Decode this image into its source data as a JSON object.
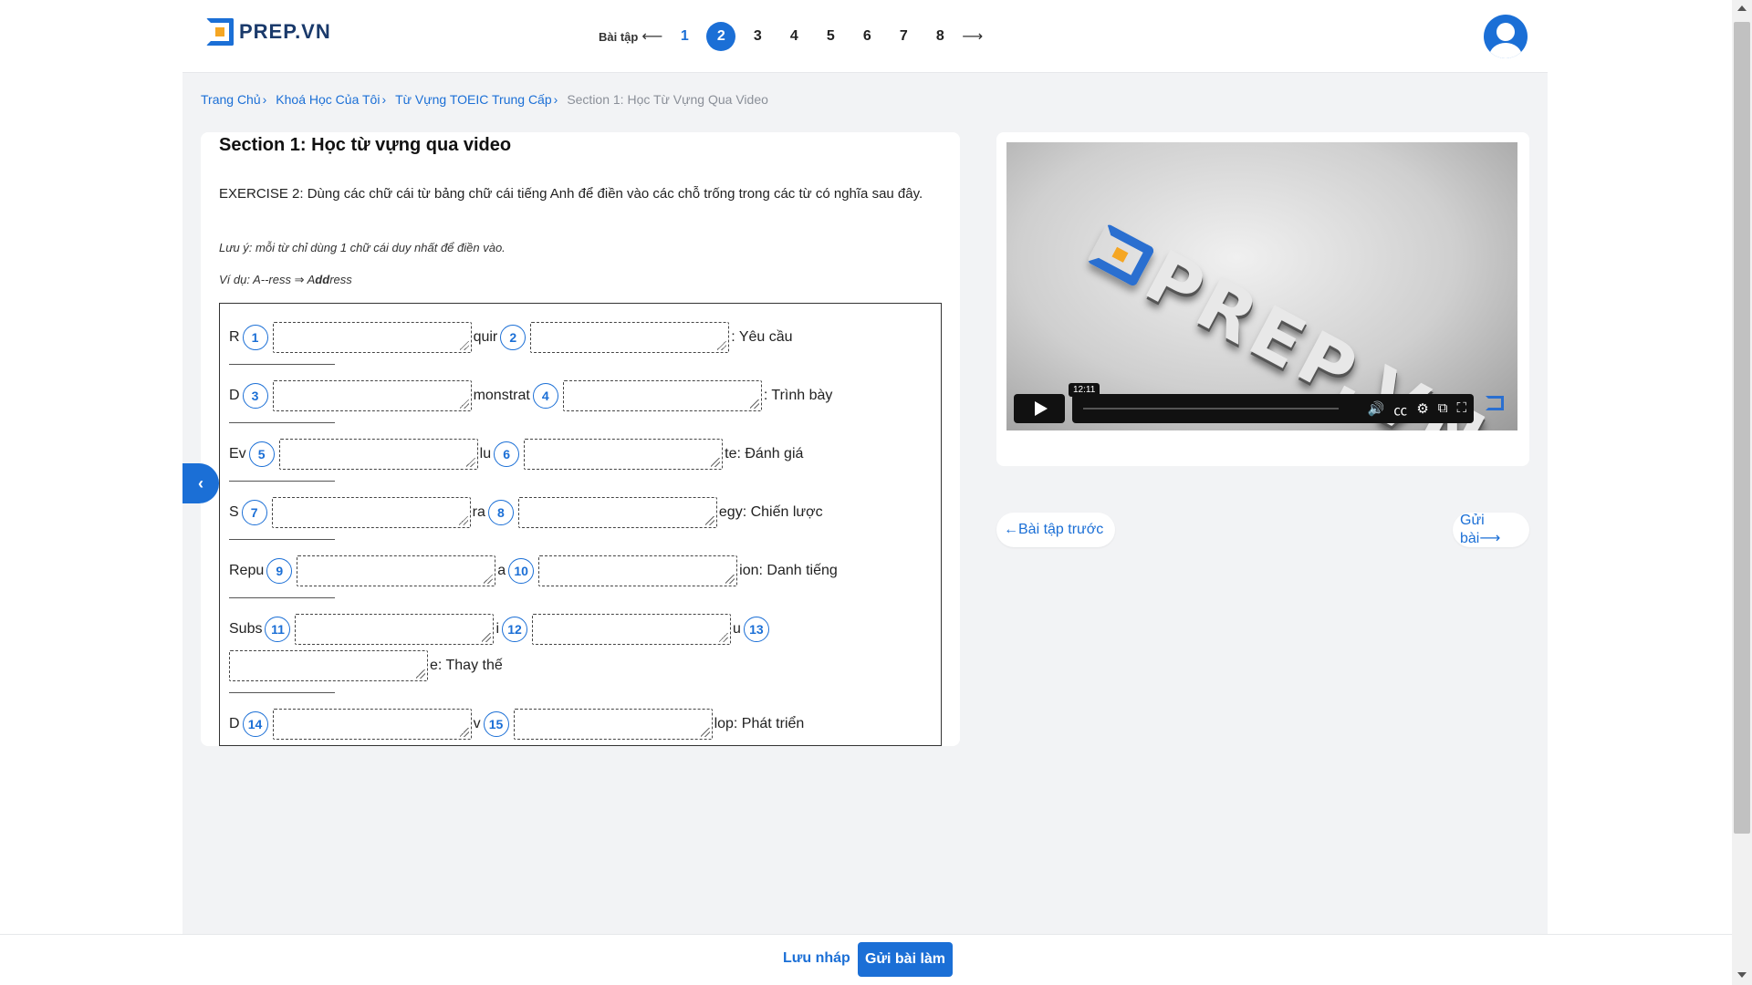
{
  "header": {
    "logo_text": "PREP.VN",
    "exercise_label": "Bài tập",
    "exercise_numbers": [
      "1",
      "2",
      "3",
      "4",
      "5",
      "6",
      "7",
      "8"
    ],
    "active_exercise": "2"
  },
  "breadcrumb": {
    "items": [
      "Trang Chủ",
      "Khoá Học Của Tôi",
      "Từ Vựng TOEIC Trung Cấp"
    ],
    "current": "Section 1: Học Từ Vựng Qua Video"
  },
  "exercise": {
    "section_title": "Section 1: Học từ vựng qua video",
    "instruction": "EXERCISE 2: Dùng các chữ cái từ bảng chữ cái tiếng Anh để điền vào các chỗ trống trong các từ có nghĩa sau đây.",
    "note": "Lưu ý: mỗi từ chỉ dùng 1 chữ cái duy nhất để điền vào.",
    "example_prefix": "Ví dụ: A--ress ⇒ A",
    "example_bold": "dd",
    "example_suffix": "ress",
    "rows": [
      {
        "p1": "R",
        "b1": "1",
        "p2": "quir",
        "b2": "2",
        "p3": ": Yêu cầu"
      },
      {
        "p1": "D",
        "b1": "3",
        "p2": "monstrat",
        "b2": "4",
        "p3": ": Trình bày"
      },
      {
        "p1": "Ev",
        "b1": "5",
        "p2": "lu",
        "b2": "6",
        "p3": "te: Đánh giá"
      },
      {
        "p1": "S",
        "b1": "7",
        "p2": "ra",
        "b2": "8",
        "p3": "egy: Chiến lược"
      },
      {
        "p1": "Repu",
        "b1": "9",
        "p2": "a",
        "b2": "10",
        "p3": "ion: Danh tiếng"
      },
      {
        "p1": "Subs",
        "b1": "11",
        "p2": "i",
        "b2": "12",
        "p3": "u",
        "b3": "13",
        "p4": "e: Thay thế"
      },
      {
        "p1": "D",
        "b1": "14",
        "p2": "v",
        "b2": "15",
        "p3": "lop: Phát triển"
      }
    ]
  },
  "video": {
    "logo_text": "PREP.VN",
    "time_tooltip": "12:11"
  },
  "nav_buttons": {
    "prev": "←Bài tập trước",
    "submit": "Gửi bài⟶"
  },
  "bottom": {
    "save_draft": "Lưu nháp",
    "submit_all": "Gửi bài làm"
  },
  "colors": {
    "accent": "#1b6fd6",
    "brand_orange": "#f5a623",
    "background": "#f2f3f5"
  }
}
